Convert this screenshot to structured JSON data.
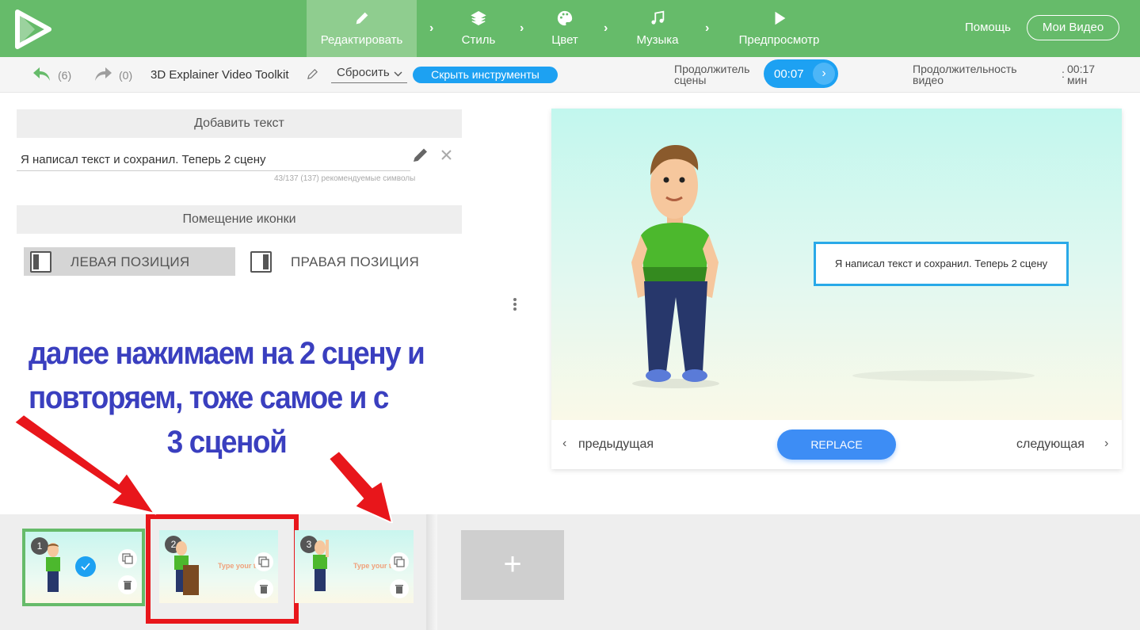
{
  "nav": {
    "steps": [
      {
        "label": "Редактировать",
        "icon": "pencil-icon"
      },
      {
        "label": "Стиль",
        "icon": "layers-icon"
      },
      {
        "label": "Цвет",
        "icon": "palette-icon"
      },
      {
        "label": "Музыка",
        "icon": "music-note-icon"
      },
      {
        "label": "Предпросмотр",
        "icon": "play-icon"
      }
    ],
    "help": "Помощь",
    "my_videos": "Мои Видео"
  },
  "toolbar": {
    "undo_count": "(6)",
    "redo_count": "(0)",
    "project_title": "3D Explainer Video Toolkit",
    "reset": "Сбросить",
    "hide_tools": "Скрыть инструменты",
    "scene_duration_label_1": "Продолжитель",
    "scene_duration_label_2": "сцены",
    "scene_duration_value": "00:07",
    "video_duration_label_1": "Продолжительность",
    "video_duration_label_2": "видео",
    "video_duration_sep": ":",
    "video_duration_value": "00:17",
    "video_duration_unit": "мин"
  },
  "editor": {
    "add_text_header": "Добавить текст",
    "text_value": "Я написал текст и сохранил. Теперь 2 сцену",
    "char_counter": "43/137 (137) рекомендуемые символы",
    "icon_placement_header": "Помещение иконки",
    "left_position": "ЛЕВАЯ ПОЗИЦИЯ",
    "right_position": "ПРАВАЯ ПОЗИЦИЯ",
    "selected_position": "left"
  },
  "annotation": {
    "line1": "далее нажимаем на 2 сцену и",
    "line2": "повторяем, тоже самое и с",
    "line3": "3 сценой",
    "color": "#3a3fbf",
    "highlight_color": "#e8161b"
  },
  "preview": {
    "textbox": "Я написал текст и сохранил. Теперь 2 сцену",
    "prev": "предыдущая",
    "next": "следующая",
    "replace": "REPLACE"
  },
  "timeline": {
    "scenes": [
      {
        "number": "1",
        "selected": true,
        "text": ""
      },
      {
        "number": "2",
        "selected": false,
        "text": "Type your t"
      },
      {
        "number": "3",
        "selected": false,
        "text": "Type your t"
      }
    ],
    "add": "+"
  },
  "colors": {
    "nav_green": "#66bb6a",
    "accent_blue": "#1da1f2",
    "selected_scene_border": "#66bb6a"
  }
}
